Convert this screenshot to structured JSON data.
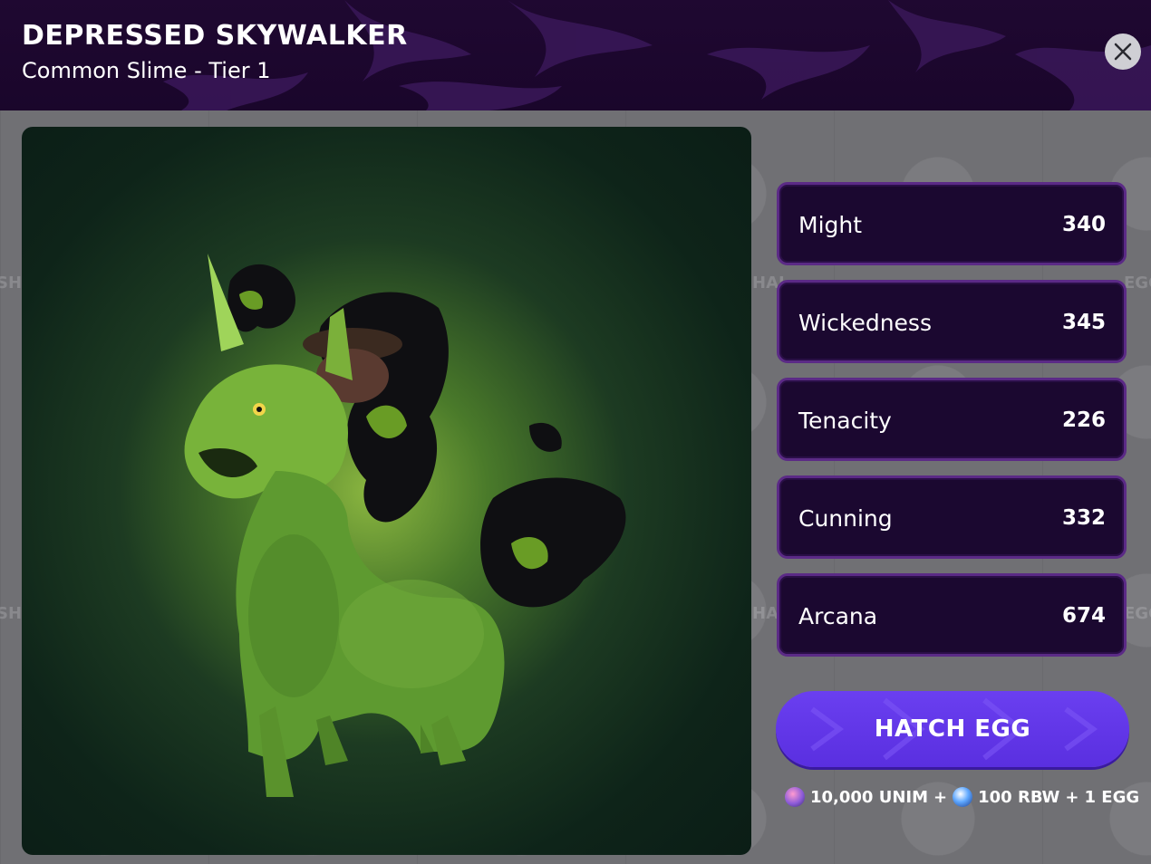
{
  "header": {
    "title": "DEPRESSED SKYWALKER",
    "subtitle": "Common Slime - Tier 1",
    "close_icon": "close-icon"
  },
  "artwork": {
    "subject": "slime-unicorn-creature"
  },
  "stats": [
    {
      "label": "Might",
      "value": "340"
    },
    {
      "label": "Wickedness",
      "value": "345"
    },
    {
      "label": "Tenacity",
      "value": "226"
    },
    {
      "label": "Cunning",
      "value": "332"
    },
    {
      "label": "Arcana",
      "value": "674"
    }
  ],
  "hatch": {
    "label": "HATCH EGG"
  },
  "cost": {
    "unim": "10,000 UNIM",
    "plus1": "+",
    "rbw": "100 RBW",
    "plus2": "+",
    "egg": "1 EGG",
    "unim_icon": "unim-token-icon",
    "rbw_icon": "rbw-token-icon"
  },
  "colors": {
    "header_bg": "#1f0831",
    "stat_bg": "#1b0830",
    "stat_border": "#5b2a86",
    "button": "#6a3ff0"
  }
}
